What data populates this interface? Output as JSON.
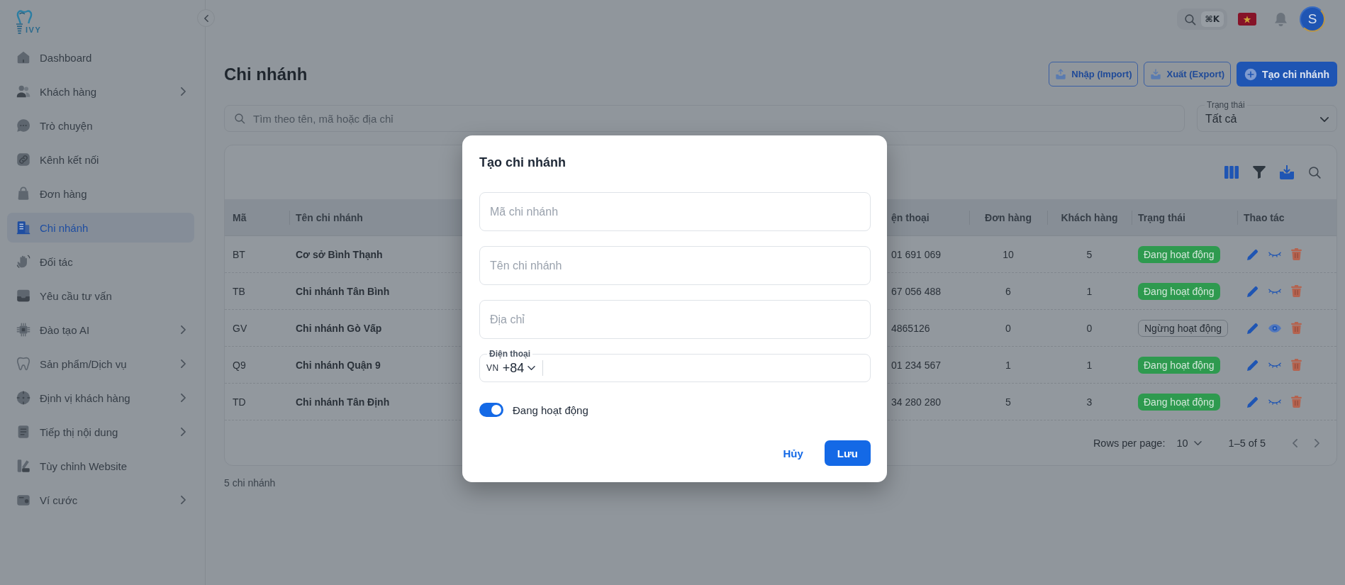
{
  "sidebar": {
    "logo_text": "IVY",
    "items": [
      {
        "label": "Dashboard",
        "has_submenu": false,
        "selected": false
      },
      {
        "label": "Khách hàng",
        "has_submenu": true,
        "selected": false
      },
      {
        "label": "Trò chuyện",
        "has_submenu": false,
        "selected": false
      },
      {
        "label": "Kênh kết nối",
        "has_submenu": false,
        "selected": false
      },
      {
        "label": "Đơn hàng",
        "has_submenu": false,
        "selected": false
      },
      {
        "label": "Chi nhánh",
        "has_submenu": false,
        "selected": true
      },
      {
        "label": "Đối tác",
        "has_submenu": false,
        "selected": false
      },
      {
        "label": "Yêu cầu tư vấn",
        "has_submenu": false,
        "selected": false
      },
      {
        "label": "Đào tạo AI",
        "has_submenu": true,
        "selected": false
      },
      {
        "label": "Sản phẩm/Dịch vụ",
        "has_submenu": true,
        "selected": false
      },
      {
        "label": "Định vị khách hàng",
        "has_submenu": true,
        "selected": false
      },
      {
        "label": "Tiếp thị nội dung",
        "has_submenu": true,
        "selected": false
      },
      {
        "label": "Tùy chỉnh Website",
        "has_submenu": false,
        "selected": false
      },
      {
        "label": "Ví cước",
        "has_submenu": true,
        "selected": false
      }
    ]
  },
  "header": {
    "search_shortcut": "⌘K",
    "avatar_initial": "S"
  },
  "page": {
    "title": "Chi nhánh",
    "actions": [
      {
        "label": "Nhập (Import)",
        "kind": "outline"
      },
      {
        "label": "Xuất (Export)",
        "kind": "outline"
      },
      {
        "label": "Tạo chi nhánh",
        "kind": "primary"
      }
    ]
  },
  "filters": {
    "search": {
      "placeholder": "Tìm theo tên, mã hoặc địa chỉ"
    },
    "status": {
      "label": "Trạng thái",
      "value": "Tất cả"
    }
  },
  "table": {
    "columns": [
      "Mã",
      "Tên chi nhánh",
      "ện thoại",
      "Đơn hàng",
      "Khách hàng",
      "Trạng thái",
      "Thao tác"
    ],
    "rows": [
      {
        "cells": [
          "BT",
          "Cơ sở Bình Thạnh",
          "01 691 069",
          "10",
          "5"
        ],
        "status": {
          "label": "Đang hoạt động",
          "active": true
        }
      },
      {
        "cells": [
          "TB",
          "Chi nhánh Tân Bình",
          "67 056 488",
          "6",
          "1"
        ],
        "status": {
          "label": "Đang hoạt động",
          "active": true
        }
      },
      {
        "cells": [
          "GV",
          "Chi nhánh Gò Vấp",
          "4865126",
          "0",
          "0"
        ],
        "status": {
          "label": "Ngừng hoạt động",
          "active": false
        }
      },
      {
        "cells": [
          "Q9",
          "Chi nhánh Quận 9",
          "01 234 567",
          "1",
          "1"
        ],
        "status": {
          "label": "Đang hoạt động",
          "active": true
        }
      },
      {
        "cells": [
          "TD",
          "Chi nhánh Tân Định",
          "34 280 280",
          "5",
          "3"
        ],
        "status": {
          "label": "Đang hoạt động",
          "active": true
        }
      }
    ],
    "pagination": {
      "rows_per_page_label": "Rows per page:",
      "rows_per_page": "10",
      "range": "1–5 of 5"
    }
  },
  "footer": {
    "count": "5 chi nhánh"
  },
  "modal": {
    "title": "Tạo chi nhánh",
    "fields": [
      {
        "placeholder": "Mã chi nhánh"
      },
      {
        "placeholder": "Tên chi nhánh"
      },
      {
        "placeholder": "Địa chỉ"
      }
    ],
    "phone": {
      "label": "Điện thoại",
      "country": "VN",
      "dial_code": "+84"
    },
    "toggle": {
      "label": "Đang hoạt động",
      "on": true
    },
    "buttons": [
      {
        "label": "Hủy",
        "kind": "text"
      },
      {
        "label": "Lưu",
        "kind": "primary"
      }
    ]
  }
}
